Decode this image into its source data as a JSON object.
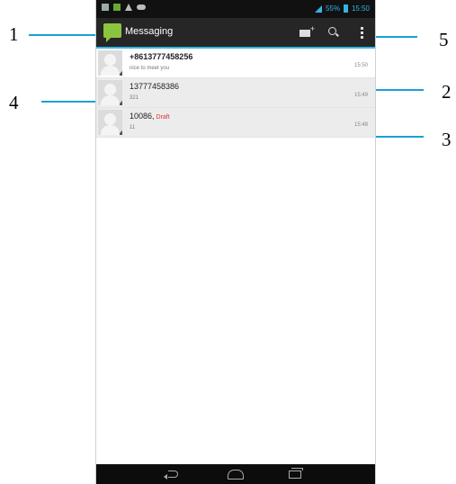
{
  "callouts": [
    "1",
    "2",
    "3",
    "4",
    "5"
  ],
  "status_bar": {
    "battery_text": "55%",
    "time": "15:50"
  },
  "action_bar": {
    "title": "Messaging",
    "accent": "#33b5e5"
  },
  "conversations": [
    {
      "from": "+8613777458256",
      "snippet": "nice to meet you",
      "time": "15:50",
      "draft": ""
    },
    {
      "from": "13777458386",
      "snippet": "321",
      "time": "15:49",
      "draft": ""
    },
    {
      "from": "10086,",
      "snippet": "11",
      "time": "15:48",
      "draft": "Draft"
    }
  ],
  "icons": [
    "messaging-app-icon",
    "compose-icon",
    "search-icon",
    "overflow-menu-icon",
    "back-icon",
    "home-icon",
    "recent-apps-icon"
  ]
}
